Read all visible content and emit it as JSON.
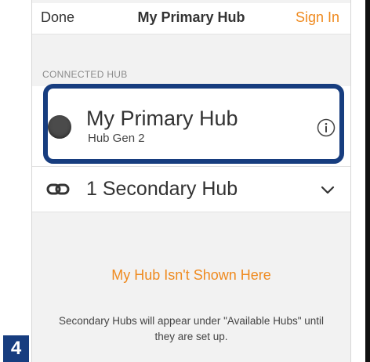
{
  "header": {
    "done_label": "Done",
    "title": "My Primary Hub",
    "signin_label": "Sign In"
  },
  "connected": {
    "section_label": "CONNECTED HUB",
    "hub_name": "My Primary Hub",
    "hub_model": "Hub Gen 2",
    "info_icon": "info-circle-icon"
  },
  "secondary": {
    "icon": "link-icon",
    "label": "1 Secondary Hub",
    "expand_icon": "chevron-down-icon"
  },
  "footer": {
    "not_shown_link": "My Hub Isn't Shown Here",
    "note": "Secondary Hubs will appear under \"Available Hubs\" until they are set up."
  },
  "step_badge": "4",
  "colors": {
    "accent": "#ef8a1f",
    "highlight": "#173d7f",
    "background": "#f2f2f2"
  }
}
